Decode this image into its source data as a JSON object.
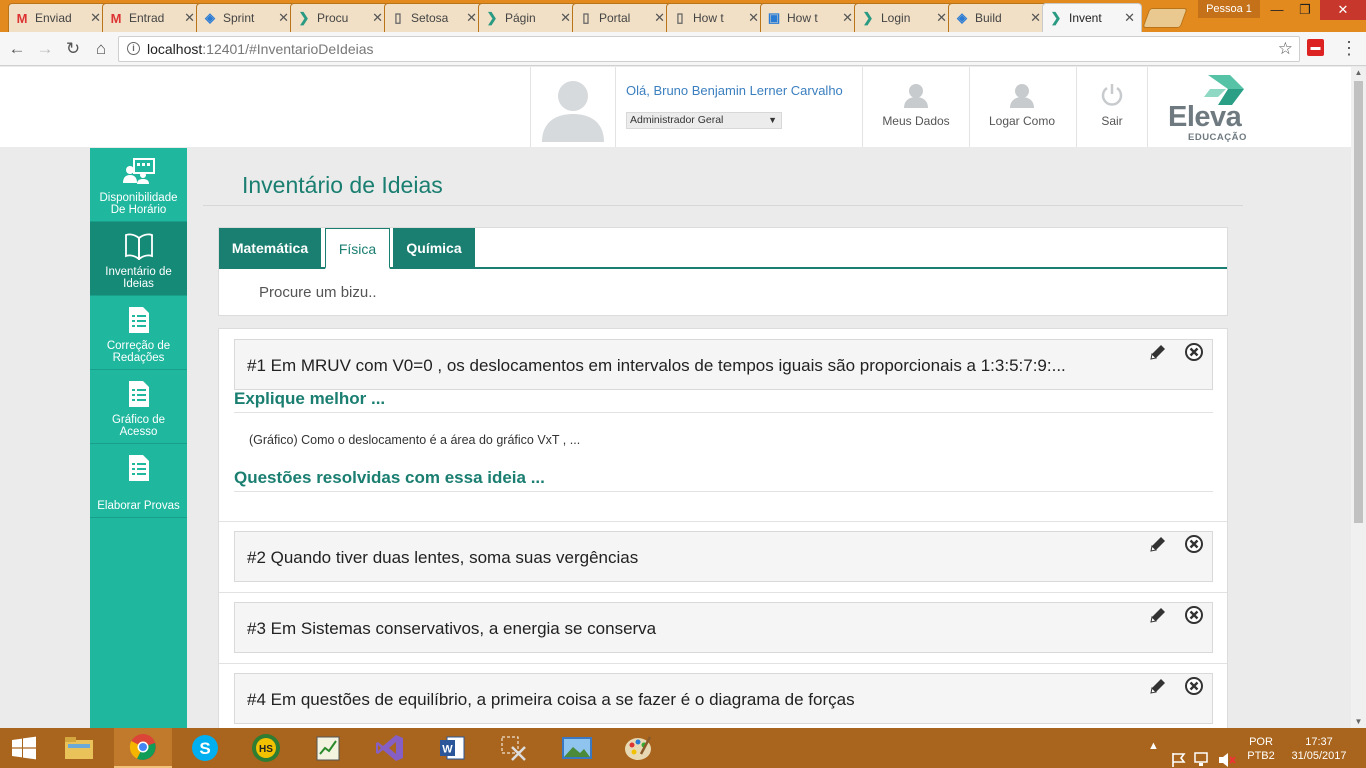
{
  "browser": {
    "tabs": [
      {
        "title": "Enviad",
        "icon": "gmail-icon"
      },
      {
        "title": "Entrad",
        "icon": "gmail-icon"
      },
      {
        "title": "Sprint",
        "icon": "vsts-icon"
      },
      {
        "title": "Procu",
        "icon": "chevron-icon"
      },
      {
        "title": "Setosa",
        "icon": "page-icon"
      },
      {
        "title": "Págin",
        "icon": "chevron-icon"
      },
      {
        "title": "Portal",
        "icon": "page-icon"
      },
      {
        "title": "How t",
        "icon": "page-icon"
      },
      {
        "title": "How t",
        "icon": "chat-icon"
      },
      {
        "title": "Login",
        "icon": "chevron-icon"
      },
      {
        "title": "Build",
        "icon": "vsts-icon"
      },
      {
        "title": "Invent",
        "icon": "chevron-icon",
        "active": true
      }
    ],
    "profile": "Pessoa 1",
    "url_host": "localhost",
    "url_path": ":12401/#InventarioDeIdeias",
    "colors": {
      "tabstrip": "#e28a1e",
      "taskbar": "#a9651d"
    }
  },
  "header": {
    "greeting": "Olá, Bruno Benjamin Lerner Carvalho",
    "role": "Administrador Geral",
    "my_data": "Meus Dados",
    "login_as": "Logar Como",
    "logout": "Sair",
    "logo_text": "Eleva",
    "logo_sub": "EDUCAÇÃO"
  },
  "sidebar": {
    "items": [
      {
        "label_1": "Disponibilidade",
        "label_2": "De Horário",
        "icon": "calendar-people-icon"
      },
      {
        "label_1": "Inventário de",
        "label_2": "Ideias",
        "icon": "open-book-icon",
        "active": true
      },
      {
        "label_1": "Correção de",
        "label_2": "Redações",
        "icon": "document-icon"
      },
      {
        "label_1": "Gráfico de",
        "label_2": "Acesso",
        "icon": "document-icon"
      },
      {
        "label_1": "Elaborar Provas",
        "icon": "document-icon"
      }
    ],
    "colors": {
      "bg": "#1fb89f",
      "active": "#148a77"
    }
  },
  "main": {
    "title": "Inventário de Ideias",
    "subjects": [
      "Matemática",
      "Física",
      "Química"
    ],
    "selected_subject": "Física",
    "search_placeholder": "Procure um bizu..",
    "accent": "#1a7e71",
    "ideas": [
      {
        "text": "#1 Em MRUV com V0=0 , os deslocamentos em intervalos de tempos iguais são proporcionais a 1:3:5:7:9:...",
        "explain_heading": "Explique melhor ...",
        "explain_text": "(Gráfico) Como o deslocamento é a área do gráfico VxT , ...",
        "questions_heading": "Questões resolvidas com essa ideia ..."
      },
      {
        "text": "#2 Quando tiver duas lentes, soma suas vergências"
      },
      {
        "text": "#3 Em Sistemas conservativos, a energia se conserva"
      },
      {
        "text": "#4 Em questões de equilíbrio, a primeira coisa a se fazer é o diagrama de forças"
      }
    ]
  },
  "taskbar": {
    "language": "POR",
    "layout": "PTB2",
    "time": "17:37",
    "date": "31/05/2017"
  }
}
